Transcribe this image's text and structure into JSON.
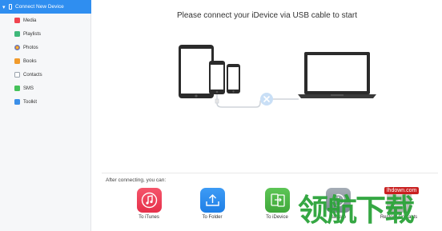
{
  "sidebar": {
    "header_label": "Connect New Device",
    "items": [
      {
        "label": "Media",
        "icon": "media-icon",
        "color": "#f0434f"
      },
      {
        "label": "Playlists",
        "icon": "playlists-icon",
        "color": "#3fb87a"
      },
      {
        "label": "Photos",
        "icon": "photos-icon",
        "color": "#f3a52c"
      },
      {
        "label": "Books",
        "icon": "books-icon",
        "color": "#f19b2c"
      },
      {
        "label": "Contacts",
        "icon": "contacts-icon",
        "color": "#9aa3ad"
      },
      {
        "label": "SMS",
        "icon": "sms-icon",
        "color": "#45c15a"
      },
      {
        "label": "Toolkit",
        "icon": "toolkit-icon",
        "color": "#3b8fe8"
      }
    ]
  },
  "main": {
    "headline": "Please connect your iDevice via USB cable to start",
    "after_label": "After connecting, you can:",
    "actions": [
      {
        "label": "To iTunes",
        "icon": "music-icon",
        "color": "#f0405a"
      },
      {
        "label": "To Folder",
        "icon": "export-icon",
        "color": "#2f8ef0"
      },
      {
        "label": "To iDevice",
        "icon": "transfer-icon",
        "color": "#4cb847"
      },
      {
        "label": "Backup",
        "icon": "backup-icon",
        "color": "#8e98a3"
      },
      {
        "label": "Restore Contacts",
        "icon": "restore-icon",
        "color": "#b9b9b9"
      }
    ]
  },
  "watermark": {
    "text": "领航下载",
    "url": "lhdown.com"
  }
}
